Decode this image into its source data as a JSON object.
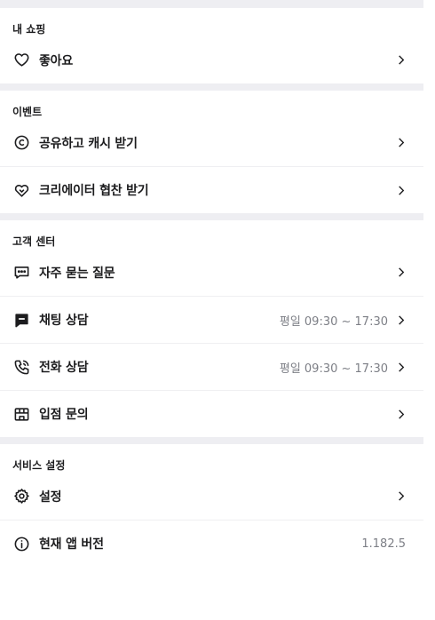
{
  "sections": [
    {
      "title": "내 쇼핑",
      "items": [
        {
          "label": "좋아요",
          "icon": "heart-icon"
        }
      ]
    },
    {
      "title": "이벤트",
      "items": [
        {
          "label": "공유하고 캐시 받기",
          "icon": "copyright-circle-icon"
        },
        {
          "label": "크리에이터 협찬 받기",
          "icon": "handshake-heart-icon"
        }
      ]
    },
    {
      "title": "고객 센터",
      "items": [
        {
          "label": "자주 묻는 질문",
          "icon": "message-dots-icon"
        },
        {
          "label": "채팅 상담",
          "icon": "chat-bubble-icon",
          "meta": "평일 09:30 ~ 17:30"
        },
        {
          "label": "전화 상담",
          "icon": "phone-icon",
          "meta": "평일 09:30 ~ 17:30"
        },
        {
          "label": "입점 문의",
          "icon": "store-icon"
        }
      ]
    },
    {
      "title": "서비스 설정",
      "items": [
        {
          "label": "설정",
          "icon": "gear-icon"
        },
        {
          "label": "현재 앱 버전",
          "icon": "info-icon",
          "version": "1.182.5"
        }
      ]
    }
  ]
}
